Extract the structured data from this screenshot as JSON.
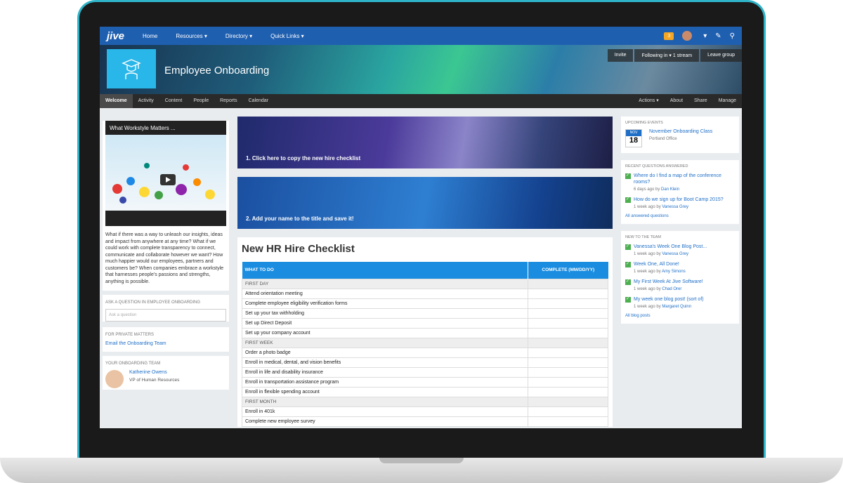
{
  "topnav": {
    "logo": "jive",
    "links": [
      "Home",
      "Resources ▾",
      "Directory ▾",
      "Quick Links ▾"
    ],
    "notifications": "3"
  },
  "banner": {
    "title": "Employee Onboarding",
    "invite": "Invite",
    "following": "Following in ▾  1 stream",
    "leave": "Leave group"
  },
  "placenav": {
    "tabs": [
      "Welcome",
      "Activity",
      "Content",
      "People",
      "Reports",
      "Calendar"
    ],
    "right": [
      "Actions ▾",
      "About",
      "Share",
      "Manage"
    ]
  },
  "left": {
    "video_title": "What Workstyle Matters ...",
    "video_text": "What if there was a way to unleash our insights, ideas and impact from anywhere at any time? What if we could work with complete transparency to connect, communicate and collaborate however we want? How much happier would our employees, partners and customers be? When companies embrace a workstyle that harnesses people's passions and strengths, anything is possible.",
    "ask_label": "Ask a question in Employee Onboarding",
    "ask_placeholder": "Ask a question",
    "private_label": "For private matters",
    "email_link": "Email the Onboarding Team",
    "team_label": "Your onboarding team",
    "member_name": "Katherine Owens",
    "member_role": "VP of Human Resources"
  },
  "middle": {
    "promo1": "1. Click here to copy the new hire checklist",
    "promo2": "2. Add your name to the title and save it!",
    "doc_title": "New HR Hire Checklist",
    "col1": "WHAT TO DO",
    "col2": "COMPLETE (MM/DD/YY)",
    "rows": [
      {
        "text": "FIRST DAY",
        "section": true
      },
      {
        "text": "Attend orientation meeting",
        "section": false
      },
      {
        "text": "Complete employee eligibility verification forms",
        "section": false
      },
      {
        "text": "Set up your tax withholding",
        "section": false
      },
      {
        "text": "Set up Direct Deposit",
        "section": false
      },
      {
        "text": "Set up your company account",
        "section": false
      },
      {
        "text": "FIRST WEEK",
        "section": true
      },
      {
        "text": "Order a photo badge",
        "section": false
      },
      {
        "text": "Enroll in medical, dental, and vision benefits",
        "section": false
      },
      {
        "text": "Enroll in life and disability insurance",
        "section": false
      },
      {
        "text": "Enroll in transportation assistance program",
        "section": false
      },
      {
        "text": "Enroll in flexible spending account",
        "section": false
      },
      {
        "text": "FIRST MONTH",
        "section": true
      },
      {
        "text": "Enroll in 401k",
        "section": false
      },
      {
        "text": "Complete new employee survey",
        "section": false
      }
    ]
  },
  "right": {
    "events_label": "Upcoming events",
    "event_month": "NOV",
    "event_day": "18",
    "event_title": "November Onboarding Class",
    "event_sub": "Portland Office",
    "questions_label": "Recent questions answered",
    "questions": [
      {
        "title": "Where do I find a map of the conference rooms?",
        "meta": "6 days ago by",
        "author": "Dan Klein"
      },
      {
        "title": "How do we sign up for Boot Camp 2015?",
        "meta": "1 week ago by",
        "author": "Vanessa Grey"
      }
    ],
    "questions_link": "All answered questions",
    "new_label": "New to the team",
    "new_items": [
      {
        "title": "Vanessa's Week One Blog Post...",
        "meta": "1 week ago by",
        "author": "Vanessa Grey"
      },
      {
        "title": "Week One, All Done!",
        "meta": "1 week ago by",
        "author": "Amy Simons"
      },
      {
        "title": "My First Week At Jive Software!",
        "meta": "1 week ago by",
        "author": "Chad Orer"
      },
      {
        "title": "My week one blog post! (sort of)",
        "meta": "1 week ago by",
        "author": "Margaret Quinn"
      }
    ],
    "new_link": "All blog posts"
  }
}
